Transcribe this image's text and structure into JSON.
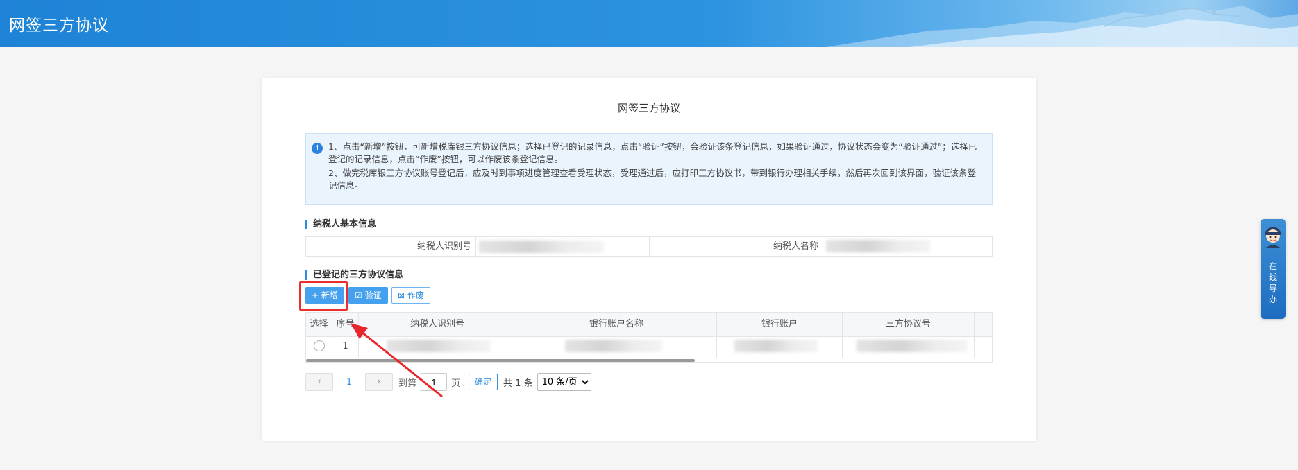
{
  "header": {
    "title": "网签三方协议"
  },
  "page": {
    "title": "网签三方协议"
  },
  "notice": {
    "line1": "1、点击“新增”按钮，可新增税库银三方协议信息；选择已登记的记录信息，点击“验证”按钮，会验证该条登记信息，如果验证通过，协议状态会变为“验证通过”；选择已登记的记录信息，点击“作废”按钮，可以作废该条登记信息。",
    "line2": "2、做完税库银三方协议账号登记后，应及时到事项进度管理查看受理状态，受理通过后，应打印三方协议书，带到银行办理相关手续，然后再次回到该界面，验证该条登记信息。"
  },
  "taxpayer": {
    "section_title": "纳税人基本信息",
    "id_label": "纳税人识别号",
    "name_label": "纳税人名称"
  },
  "agreements": {
    "section_title": "已登记的三方协议信息",
    "add_label": "+ 新增",
    "verify_label": "验证",
    "void_label": "作废",
    "columns": [
      "选择",
      "序号",
      "纳税人识别号",
      "银行账户名称",
      "银行账户",
      "三方协议号"
    ],
    "rows": [
      {
        "index": "1"
      }
    ]
  },
  "pagination": {
    "current_page": "1",
    "goto_label": "到第",
    "page_input": "1",
    "page_unit": "页",
    "confirm_label": "确定",
    "total_label": "共 1 条",
    "page_size": "10 条/页"
  },
  "side_help": {
    "label": "在线导办"
  },
  "colors": {
    "primary": "#45a0ee",
    "header": "#2c93e0",
    "highlight": "#ea2d2d"
  }
}
